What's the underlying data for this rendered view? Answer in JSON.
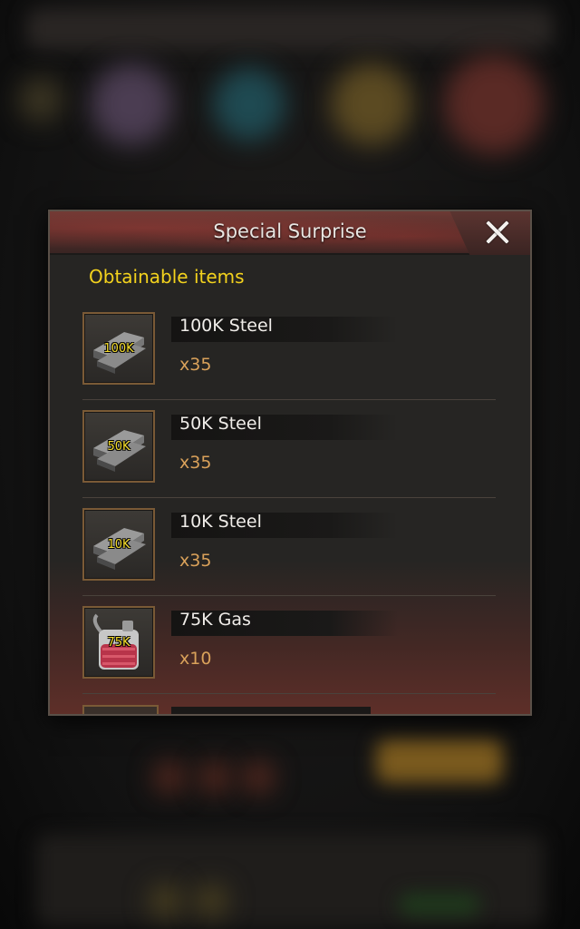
{
  "dialog": {
    "title": "Special Surprise",
    "section_label": "Obtainable items",
    "close_icon": "close-icon"
  },
  "items": [
    {
      "name": "100K Steel",
      "count": "x35",
      "badge": "100K",
      "icon": "steel-ingot-icon"
    },
    {
      "name": "50K Steel",
      "count": "x35",
      "badge": "50K",
      "icon": "steel-ingot-icon"
    },
    {
      "name": "10K Steel",
      "count": "x35",
      "badge": "10K",
      "icon": "steel-ingot-icon"
    },
    {
      "name": "75K Gas",
      "count": "x10",
      "badge": "75K",
      "icon": "gas-can-icon"
    }
  ],
  "colors": {
    "section_label": "#f3d21d",
    "count": "#d9a15a",
    "badge": "#f6dd2a",
    "thumb_border": "#7a5a36"
  }
}
